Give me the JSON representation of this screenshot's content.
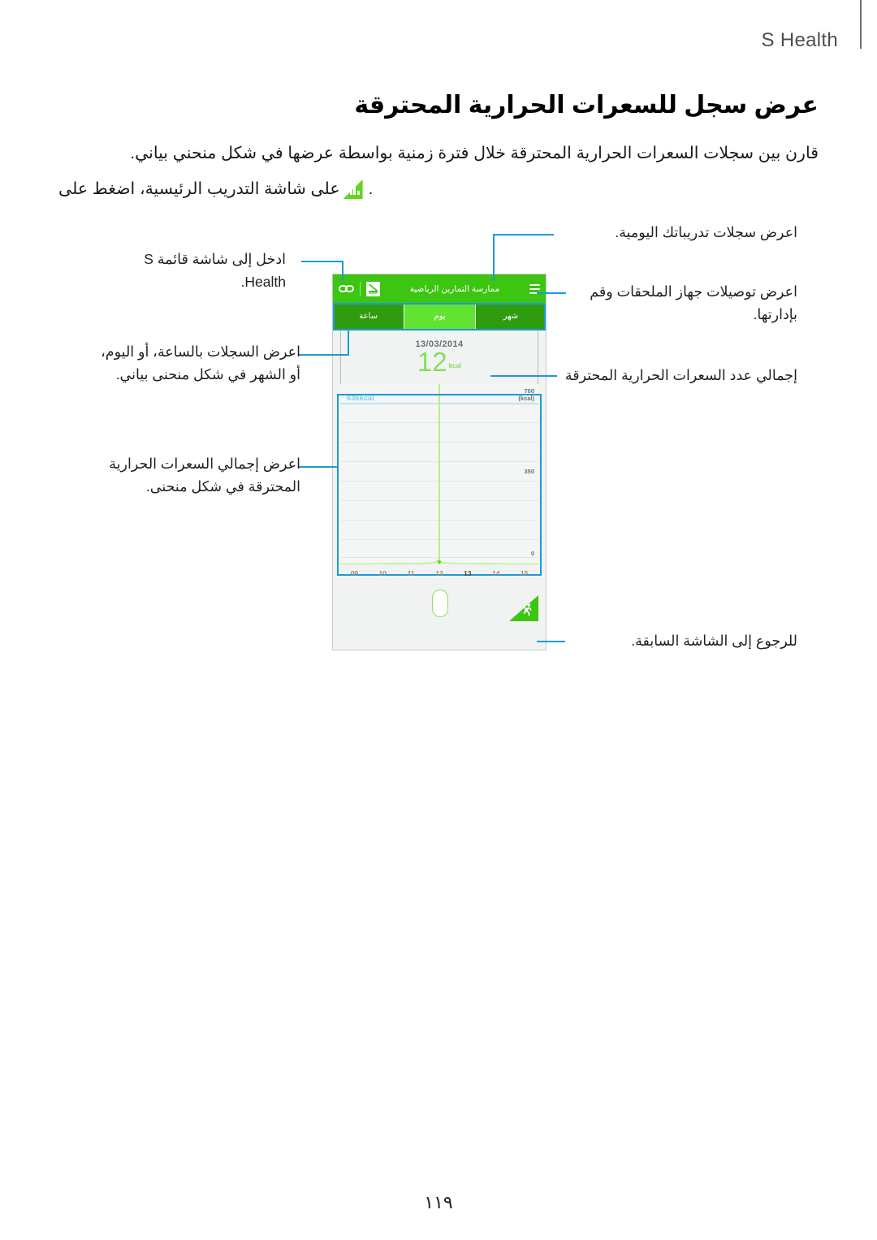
{
  "header": {
    "title": "S Health"
  },
  "section": {
    "heading": "عرض سجل للسعرات الحرارية المحترقة",
    "paragraph_1": "قارن بين سجلات السعرات الحرارية المحترقة خلال فترة زمنية بواسطة عرضها في شكل منحني بياني.",
    "paragraph_2_before": "على شاشة التدريب الرئيسية، اضغط على",
    "paragraph_2_after": ".",
    "chart_icon_name": "bar-chart-icon"
  },
  "callouts": {
    "menu": "ادخل إلى شاشة قائمة S Health.",
    "period_tabs": "اعرض السجلات بالساعة، أو اليوم، أو الشهر في شكل منحنى بياني.",
    "total_curve": "اعرض إجمالي السعرات الحرارية المحترقة في شكل منحنى.",
    "daily_logs": "اعرض سجلات تدريباتك اليومية.",
    "accessories": "اعرض توصيلات جهاز الملحقات وقم بإدارتها.",
    "total_burned": "إجمالي عدد السعرات الحرارية المحترقة",
    "back": "للرجوع إلى الشاشة السابقة."
  },
  "phone": {
    "app_bar": {
      "title": "ممارسة التمارين الرياضية",
      "menu_icon": "hamburger-icon",
      "log_icon": "exercise-log-icon",
      "link_icon": "accessory-link-icon"
    },
    "tabs": [
      {
        "label": "شهر",
        "active": false
      },
      {
        "label": "يوم",
        "active": true
      },
      {
        "label": "ساعة",
        "active": false
      }
    ],
    "summary": {
      "date": "13/03/2014",
      "value": "12",
      "unit": "kcal"
    },
    "footer": {
      "back_icon": "runner-icon"
    }
  },
  "chart_data": {
    "type": "line",
    "title": "",
    "xlabel": "",
    "ylabel": "kcal",
    "categories": [
      "09",
      "10",
      "11",
      "12",
      "13",
      "14",
      "15"
    ],
    "values": [
      0,
      0,
      0,
      0,
      12,
      0,
      0
    ],
    "ylim": [
      0,
      700
    ],
    "ytick_labels": [
      "700\n(kcal)",
      "350",
      "0"
    ],
    "axis_top_label_line1": "700",
    "axis_top_label_line2": "(kcal)",
    "axis_mid_label": "350",
    "axis_zero_label": "0",
    "goal_line_value": 636,
    "goal_line_label": "636kcal",
    "selected_category": "13",
    "grid": true,
    "legend": "none"
  },
  "colors": {
    "brand_green": "#3cc511",
    "tab_inactive_green": "#2f9c10",
    "tab_active_green": "#62e331",
    "value_green": "#84e05d",
    "goal_blue": "#7fd0e0",
    "callout_blue": "#1c9ad6",
    "panel_gray": "#f1f2f2"
  },
  "footer": {
    "page_number": "١١٩"
  }
}
